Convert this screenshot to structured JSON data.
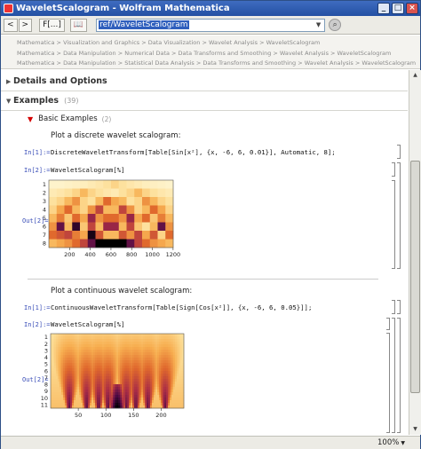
{
  "window": {
    "title": "WaveletScalogram - Wolfram Mathematica"
  },
  "toolbar": {
    "back": "<",
    "forward": ">",
    "func_list": "F[...]",
    "book_icon": "book-icon",
    "address_value": "ref/WaveletScalogram"
  },
  "breadcrumbs": [
    "Mathematica > Visualization and Graphics > Data Visualization > Wavelet Analysis > WaveletScalogram",
    "Mathematica > Data Manipulation > Numerical Data > Data Transforms and Smoothing > Wavelet Analysis > WaveletScalogram",
    "Mathematica > Data Manipulation > Statistical Data Analysis > Data Transforms and Smoothing > Wavelet Analysis > WaveletScalogram"
  ],
  "sections": {
    "details": {
      "label": "Details and Options"
    },
    "examples": {
      "label": "Examples",
      "count": "(39)"
    },
    "basic": {
      "label": "Basic Examples",
      "count": "(2)"
    }
  },
  "example1": {
    "text": "Plot a discrete wavelet scalogram:",
    "in1_label": "In[1]:=",
    "in1_code": "DiscreteWaveletTransform[Table[Sin[x²], {x, -6, 6, 0.01}], Automatic, 8];",
    "in2_label": "In[2]:=",
    "in2_code": "WaveletScalogram[%]",
    "out_label": "Out[2]="
  },
  "example2": {
    "text": "Plot a continuous wavelet scalogram:",
    "in1_label": "In[1]:=",
    "in1_code": "ContinuousWaveletTransform[Table[Sign[Cos[x²]], {x, -6, 6, 0.05}]];",
    "in2_label": "In[2]:=",
    "in2_code": "WaveletScalogram[%]",
    "out_label": "Out[2]="
  },
  "status": {
    "zoom": "100%"
  },
  "chart_data": [
    {
      "type": "heatmap",
      "x_ticks": [
        200,
        400,
        600,
        800,
        1000,
        1200
      ],
      "xlim": [
        0,
        1201
      ],
      "y_ticks": [
        1,
        2,
        3,
        4,
        5,
        6,
        7,
        8
      ],
      "rows": [
        {
          "level": 1,
          "values": [
            0.05,
            0.05,
            0.06,
            0.07,
            0.08,
            0.1,
            0.12,
            0.15,
            0.2,
            0.15,
            0.12,
            0.1,
            0.08,
            0.07,
            0.06,
            0.05
          ]
        },
        {
          "level": 2,
          "values": [
            0.1,
            0.12,
            0.15,
            0.2,
            0.3,
            0.2,
            0.15,
            0.12,
            0.1,
            0.15,
            0.2,
            0.3,
            0.2,
            0.15,
            0.12,
            0.1
          ]
        },
        {
          "level": 3,
          "values": [
            0.15,
            0.2,
            0.3,
            0.4,
            0.2,
            0.15,
            0.3,
            0.5,
            0.35,
            0.3,
            0.15,
            0.2,
            0.4,
            0.3,
            0.2,
            0.15
          ]
        },
        {
          "level": 4,
          "values": [
            0.2,
            0.35,
            0.5,
            0.3,
            0.2,
            0.4,
            0.6,
            0.3,
            0.3,
            0.6,
            0.4,
            0.2,
            0.3,
            0.5,
            0.35,
            0.2
          ]
        },
        {
          "level": 5,
          "values": [
            0.3,
            0.45,
            0.25,
            0.5,
            0.35,
            0.7,
            0.4,
            0.5,
            0.5,
            0.4,
            0.7,
            0.35,
            0.5,
            0.25,
            0.45,
            0.3
          ]
        },
        {
          "level": 6,
          "values": [
            0.4,
            0.8,
            0.3,
            0.9,
            0.25,
            0.6,
            0.3,
            0.7,
            0.7,
            0.3,
            0.6,
            0.25,
            0.15,
            0.3,
            0.8,
            0.4
          ]
        },
        {
          "level": 7,
          "values": [
            0.5,
            0.55,
            0.6,
            0.45,
            0.35,
            0.95,
            0.55,
            0.3,
            0.3,
            0.55,
            0.4,
            0.6,
            0.35,
            0.55,
            0.2,
            0.5
          ]
        },
        {
          "level": 8,
          "values": [
            0.3,
            0.35,
            0.4,
            0.5,
            0.6,
            0.8,
            1.0,
            1.0,
            1.0,
            1.0,
            0.8,
            0.6,
            0.5,
            0.4,
            0.35,
            0.3
          ]
        }
      ]
    },
    {
      "type": "heatmap",
      "x_ticks": [
        50,
        100,
        150,
        200
      ],
      "xlim": [
        0,
        241
      ],
      "y_ticks": [
        1,
        2,
        3,
        4,
        5,
        6,
        7,
        8,
        9,
        10,
        11
      ],
      "ylim": [
        0.5,
        11.5
      ],
      "style": "continuous scalogram with V-shaped ridges"
    }
  ]
}
